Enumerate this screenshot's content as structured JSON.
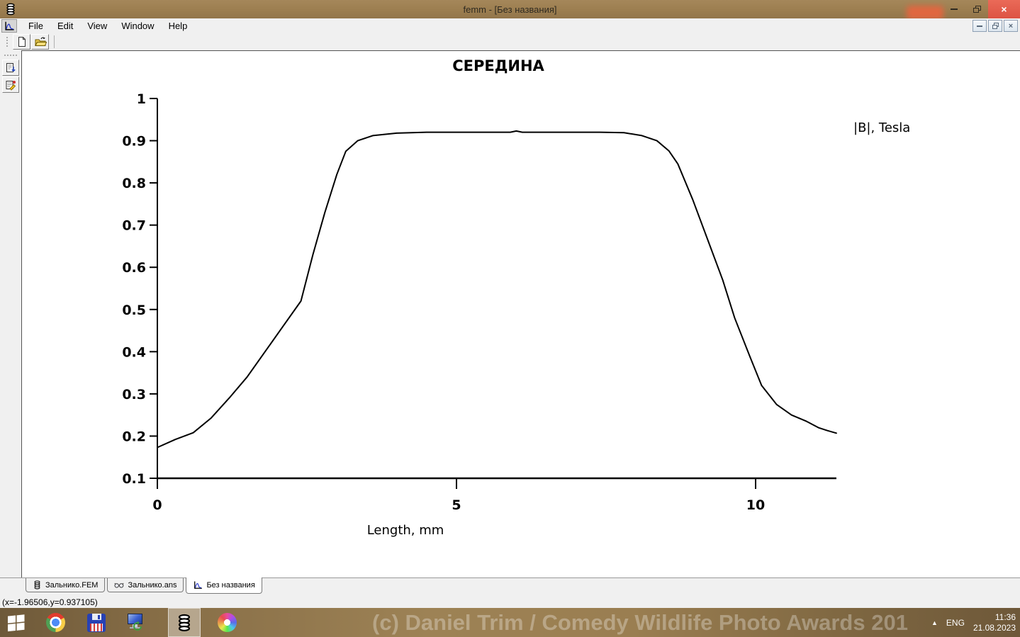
{
  "titlebar": {
    "title": "femm - [Без названия]",
    "close_glyph": "×"
  },
  "menubar": {
    "items": [
      "File",
      "Edit",
      "View",
      "Window",
      "Help"
    ],
    "mdi_close_glyph": "×"
  },
  "chart_data": {
    "type": "line",
    "title": "СЕРЕДИНА",
    "legend": "|B|, Tesla",
    "xlabel": "Length, mm",
    "xlim": [
      0,
      11.35
    ],
    "ylim": [
      0.1,
      1.0
    ],
    "x_ticks": [
      0,
      5,
      10
    ],
    "y_ticks": [
      0.1,
      0.2,
      0.3,
      0.4,
      0.5,
      0.6,
      0.7,
      0.8,
      0.9,
      1
    ],
    "grid": false,
    "line_color": "#000000",
    "series": [
      {
        "name": "|B|, Tesla",
        "x": [
          0,
          0.3,
          0.6,
          0.9,
          1.2,
          1.5,
          1.8,
          2.1,
          2.4,
          2.6,
          2.8,
          3.0,
          3.15,
          3.35,
          3.6,
          4.0,
          4.5,
          5.0,
          5.5,
          5.9,
          6.0,
          6.1,
          6.2,
          6.6,
          7.0,
          7.4,
          7.8,
          8.1,
          8.35,
          8.55,
          8.7,
          8.95,
          9.2,
          9.45,
          9.65,
          9.9,
          10.1,
          10.35,
          10.6,
          10.85,
          11.05,
          11.2,
          11.35
        ],
        "y": [
          0.173,
          0.192,
          0.208,
          0.243,
          0.29,
          0.34,
          0.4,
          0.46,
          0.52,
          0.63,
          0.73,
          0.82,
          0.875,
          0.9,
          0.912,
          0.918,
          0.92,
          0.92,
          0.92,
          0.92,
          0.923,
          0.92,
          0.92,
          0.92,
          0.92,
          0.92,
          0.919,
          0.912,
          0.9,
          0.876,
          0.845,
          0.76,
          0.665,
          0.57,
          0.48,
          0.39,
          0.32,
          0.275,
          0.25,
          0.235,
          0.22,
          0.213,
          0.207
        ]
      }
    ]
  },
  "tabs": [
    {
      "label": "Зальнико.FEM",
      "icon": "coil-icon",
      "active": false
    },
    {
      "label": "Зальнико.ans",
      "icon": "glasses-icon",
      "active": false
    },
    {
      "label": "Без названия",
      "icon": "plot-icon",
      "active": true
    }
  ],
  "statusbar": {
    "coords": "(x=-1.96506,y=0.937105)"
  },
  "taskbar": {
    "watermark": "(c) Daniel Trim / Comedy Wildlife Photo Awards 201",
    "tray_arrow": "▲",
    "language": "ENG",
    "time": "11:36",
    "date": "21.08.2023",
    "icons": [
      "start",
      "chrome",
      "floppy-app",
      "remote-desktop",
      "femm",
      "color-wheel"
    ]
  },
  "colors": {
    "titlebar": "#9b7d4f",
    "close_button": "#dd5343",
    "toolbar_bg": "#f0f0f0",
    "taskbar_brown": "#9d8255",
    "plot_line": "#000000",
    "plot_curve_icon_blue": "#2233cc"
  }
}
